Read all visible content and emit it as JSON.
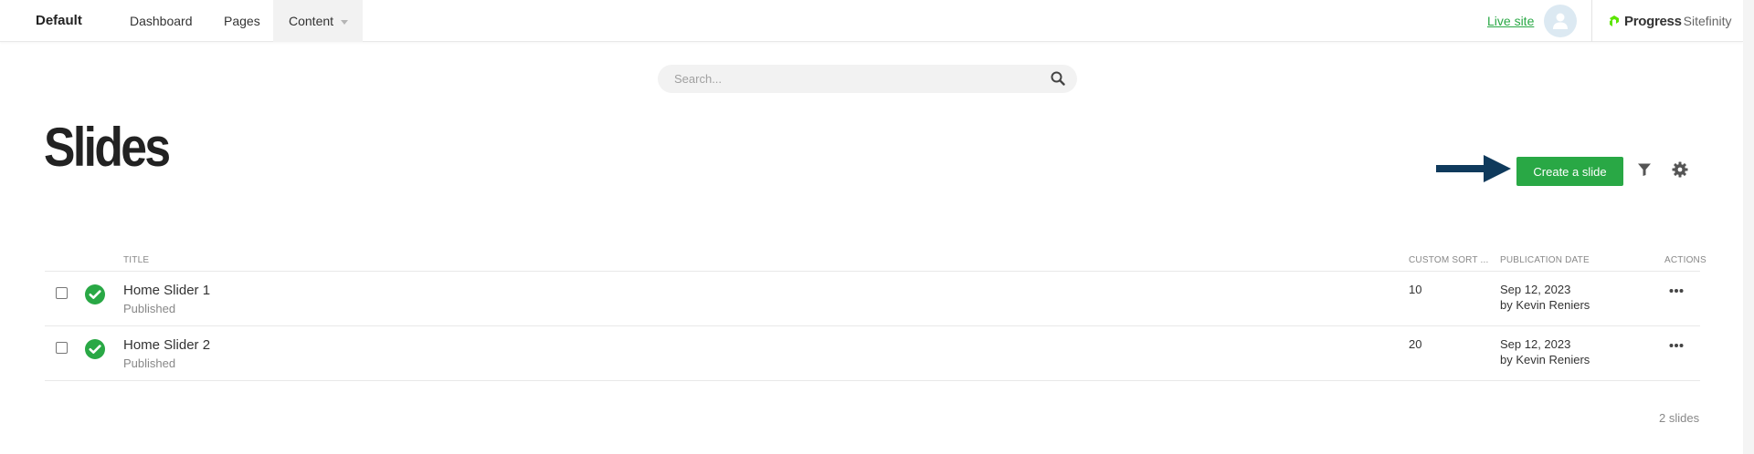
{
  "topbar": {
    "site_name": "Default",
    "nav": [
      {
        "label": "Dashboard"
      },
      {
        "label": "Pages"
      },
      {
        "label": "Content"
      }
    ],
    "live_site": "Live site",
    "brand_progress": "Progress",
    "brand_sitefinity": "Sitefinity"
  },
  "search": {
    "placeholder": "Search..."
  },
  "page": {
    "title": "Slides",
    "create_label": "Create a slide"
  },
  "table": {
    "columns": {
      "title": "Title",
      "sort": "Custom sort ...",
      "date": "Publication date",
      "actions": "Actions"
    },
    "rows": [
      {
        "title": "Home Slider 1",
        "status": "Published",
        "sort": "10",
        "date": "Sep 12, 2023",
        "author": "by Kevin Reniers"
      },
      {
        "title": "Home Slider 2",
        "status": "Published",
        "sort": "20",
        "date": "Sep 12, 2023",
        "author": "by Kevin Reniers"
      }
    ],
    "count": "2 slides"
  },
  "colors": {
    "accent": "#29a845",
    "arrow": "#0f3a5c"
  },
  "icons": {
    "search": "search-icon",
    "filter": "filter-icon",
    "settings": "gear-icon",
    "status": "check-circle-icon",
    "more": "more-horizontal-icon",
    "avatar": "user-avatar-icon"
  }
}
